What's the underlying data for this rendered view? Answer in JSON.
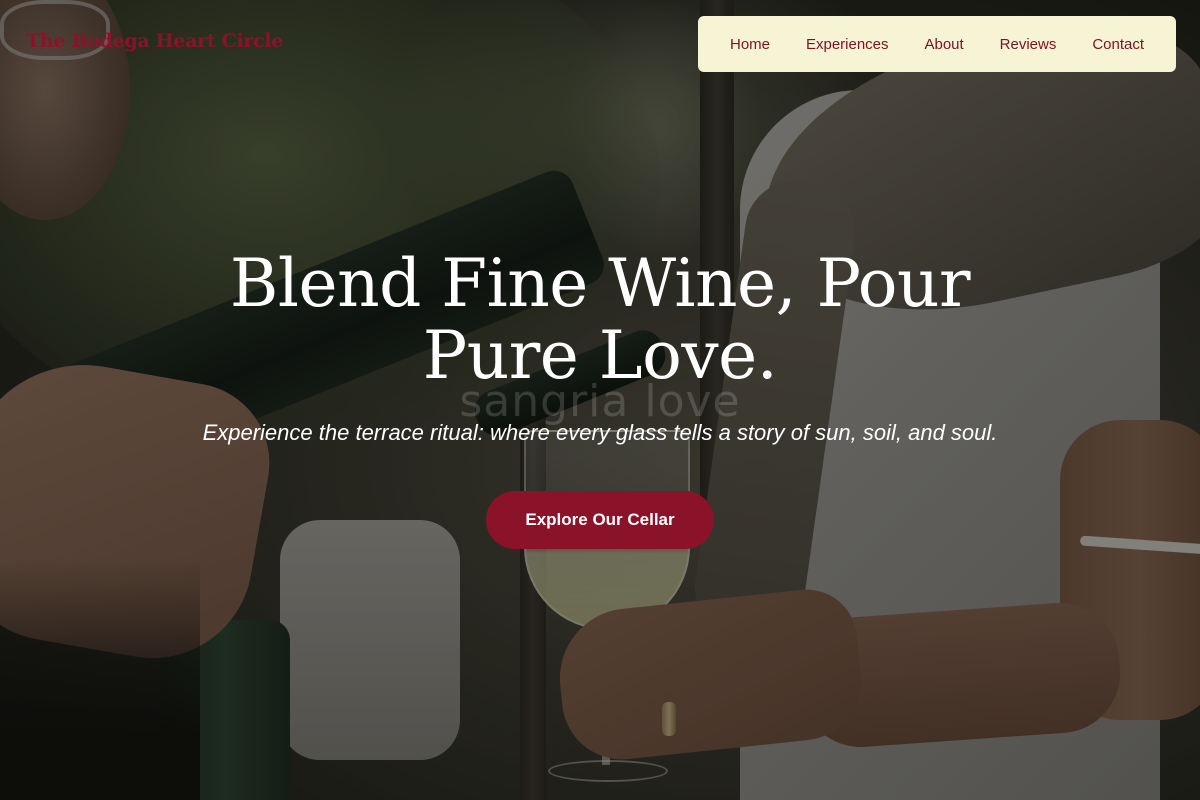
{
  "header": {
    "logo_text": "The Bodega Heart Circle",
    "nav": [
      {
        "label": "Home"
      },
      {
        "label": "Experiences"
      },
      {
        "label": "About"
      },
      {
        "label": "Reviews"
      },
      {
        "label": "Contact"
      }
    ]
  },
  "hero": {
    "title": "Blend Fine Wine, Pour Pure Love.",
    "subtitle": "Experience the terrace ritual: where every glass tells a story of sun, soil, and soul.",
    "cta_label": "Explore Our Cellar",
    "watermark_text": "sangria love"
  },
  "colors": {
    "brand": "#8b1329",
    "nav_background": "#f6f4d4",
    "hero_text": "#ffffff"
  }
}
